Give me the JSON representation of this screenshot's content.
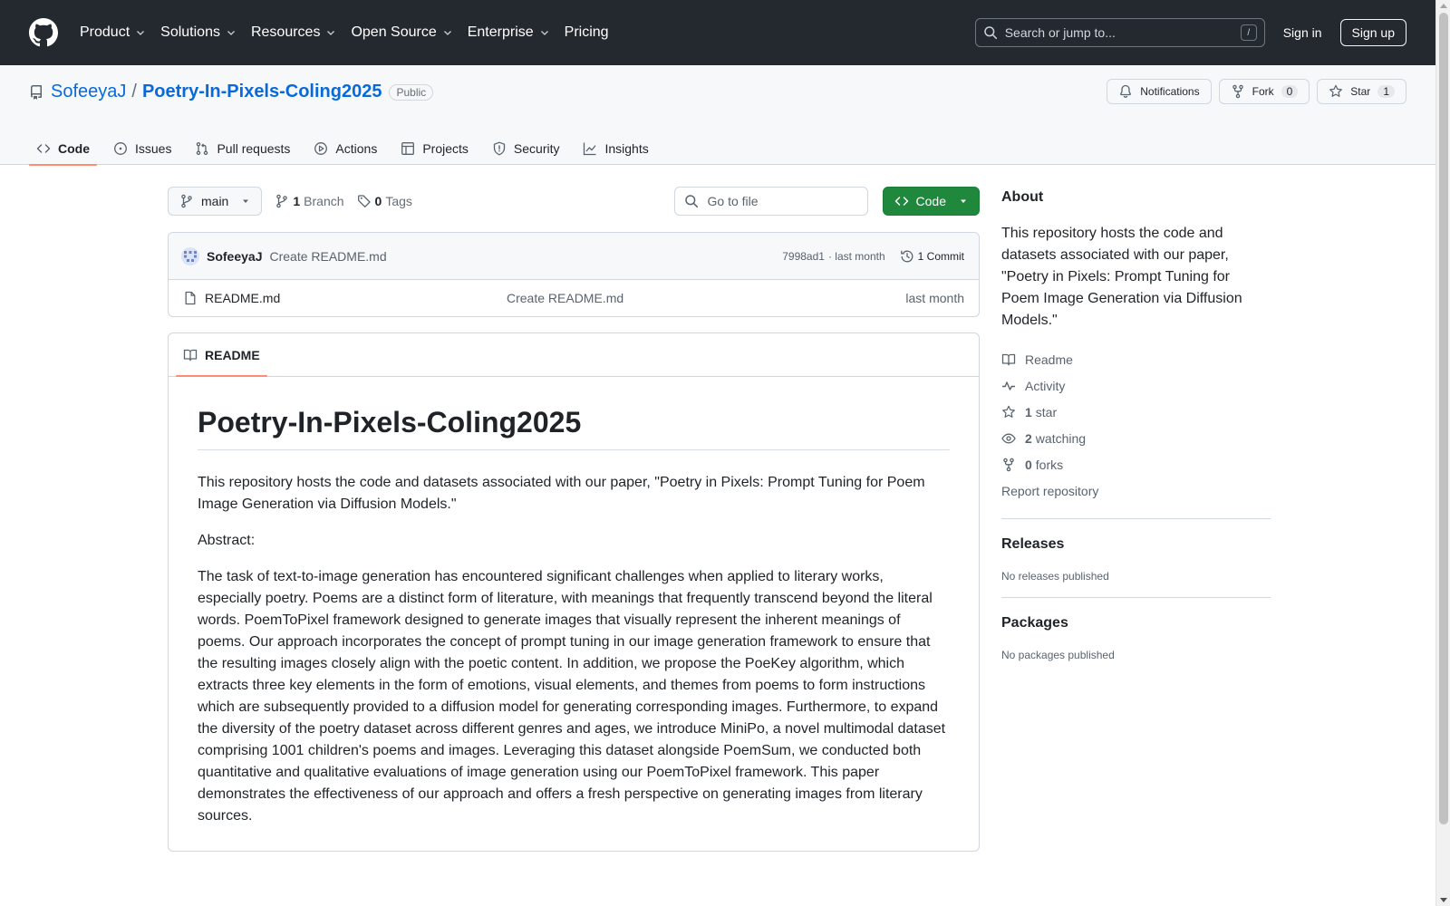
{
  "header": {
    "nav": [
      "Product",
      "Solutions",
      "Resources",
      "Open Source",
      "Enterprise",
      "Pricing"
    ],
    "search_placeholder": "Search or jump to...",
    "search_shortcut": "/",
    "sign_in": "Sign in",
    "sign_up": "Sign up"
  },
  "repo": {
    "owner": "SofeeyaJ",
    "separator": "/",
    "name": "Poetry-In-Pixels-Coling2025",
    "visibility": "Public",
    "notifications_label": "Notifications",
    "fork_label": "Fork",
    "fork_count": "0",
    "star_label": "Star",
    "star_count": "1",
    "tabs": [
      "Code",
      "Issues",
      "Pull requests",
      "Actions",
      "Projects",
      "Security",
      "Insights"
    ]
  },
  "toolbar": {
    "branch": "main",
    "branch_count": "1",
    "branch_label": "Branch",
    "tag_count": "0",
    "tag_label": "Tags",
    "goto_placeholder": "Go to file",
    "code_button": "Code"
  },
  "commit": {
    "author": "SofeeyaJ",
    "message": "Create README.md",
    "sha": "7998ad1",
    "time": "· last month",
    "count_label": "1 Commit"
  },
  "files": [
    {
      "name": "README.md",
      "commit": "Create README.md",
      "date": "last month"
    }
  ],
  "readme": {
    "tab_label": "README",
    "title": "Poetry-In-Pixels-Coling2025",
    "intro": "This repository hosts the code and datasets associated with our paper, \"Poetry in Pixels: Prompt Tuning for Poem Image Generation via Diffusion Models.\"",
    "abstract_label": "Abstract:",
    "abstract": "The task of text-to-image generation has encountered significant challenges when applied to literary works, especially poetry. Poems are a distinct form of literature, with meanings that frequently transcend beyond the literal words. PoemToPixel framework designed to generate images that visually represent the inherent meanings of poems. Our approach incorporates the concept of prompt tuning in our image generation framework to ensure that the resulting images closely align with the poetic content. In addition, we propose the PoeKey algorithm, which extracts three key elements in the form of emotions, visual elements, and themes from poems to form instructions which are subsequently provided to a diffusion model for generating corresponding images. Furthermore, to expand the diversity of the poetry dataset across different genres and ages, we introduce MiniPo, a novel multimodal dataset comprising 1001 children's poems and images. Leveraging this dataset alongside PoemSum, we conducted both quantitative and qualitative evaluations of image generation using our PoemToPixel framework. This paper demonstrates the effectiveness of our approach and offers a fresh perspective on generating images from literary sources."
  },
  "sidebar": {
    "about_title": "About",
    "about_text": "This repository hosts the code and datasets associated with our paper, \"Poetry in Pixels: Prompt Tuning for Poem Image Generation via Diffusion Models.\"",
    "readme_link": "Readme",
    "activity_link": "Activity",
    "stars_count": "1",
    "stars_label": "star",
    "watching_count": "2",
    "watching_label": "watching",
    "forks_count": "0",
    "forks_label": "forks",
    "report_link": "Report repository",
    "releases_title": "Releases",
    "releases_empty": "No releases published",
    "packages_title": "Packages",
    "packages_empty": "No packages published"
  },
  "colors": {
    "header_bg": "#24292f",
    "link": "#0969da",
    "code_button": "#1f883d",
    "active_tab_underline": "#fd8c73"
  },
  "icons": [
    "github-logo-icon",
    "chevron-down-icon",
    "search-icon",
    "repo-icon",
    "bell-icon",
    "fork-icon",
    "star-icon",
    "code-icon",
    "issue-icon",
    "pull-request-icon",
    "play-icon",
    "table-icon",
    "shield-icon",
    "graph-icon",
    "branch-icon",
    "tag-icon",
    "history-icon",
    "file-icon",
    "book-icon",
    "pulse-icon",
    "eye-icon"
  ]
}
